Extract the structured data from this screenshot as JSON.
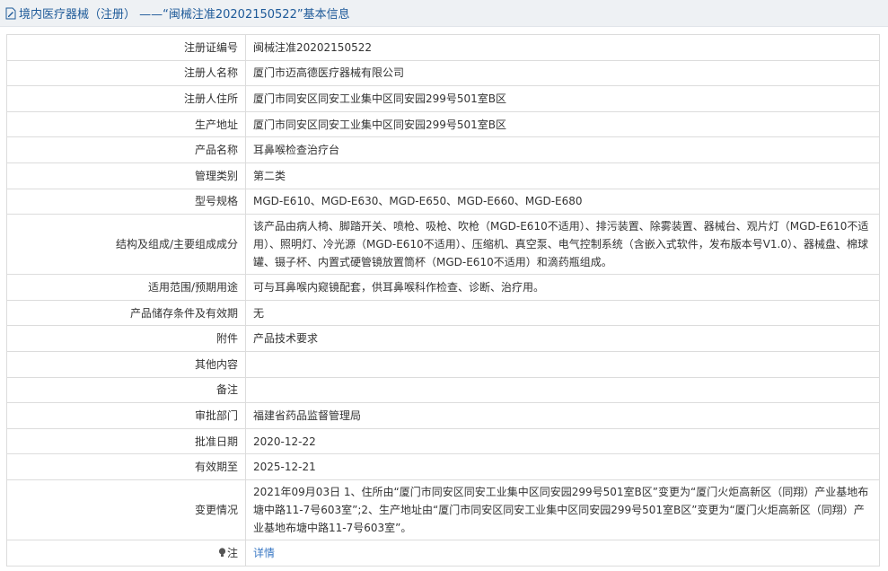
{
  "header": {
    "title": "境内医疗器械（注册） ——“闽械注准20202150522”基本信息"
  },
  "rows": [
    {
      "label": "注册证编号",
      "value": "闽械注准20202150522"
    },
    {
      "label": "注册人名称",
      "value": "厦门市迈高德医疗器械有限公司"
    },
    {
      "label": "注册人住所",
      "value": "厦门市同安区同安工业集中区同安园299号501室B区"
    },
    {
      "label": "生产地址",
      "value": "厦门市同安区同安工业集中区同安园299号501室B区"
    },
    {
      "label": "产品名称",
      "value": "耳鼻喉检查治疗台"
    },
    {
      "label": "管理类别",
      "value": "第二类"
    },
    {
      "label": "型号规格",
      "value": "MGD-E610、MGD-E630、MGD-E650、MGD-E660、MGD-E680"
    },
    {
      "label": "结构及组成/主要组成成分",
      "value": "该产品由病人椅、脚踏开关、喷枪、吸枪、吹枪（MGD-E610不适用）、排污装置、除雾装置、器械台、观片灯（MGD-E610不适用）、照明灯、冷光源（MGD-E610不适用）、压缩机、真空泵、电气控制系统（含嵌入式软件，发布版本号V1.0）、器械盘、棉球罐、镊子杯、内置式硬管镜放置筒杯（MGD-E610不适用）和滴药瓶组成。"
    },
    {
      "label": "适用范围/预期用途",
      "value": "可与耳鼻喉内窥镜配套，供耳鼻喉科作检查、诊断、治疗用。"
    },
    {
      "label": "产品储存条件及有效期",
      "value": "无"
    },
    {
      "label": "附件",
      "value": "产品技术要求"
    },
    {
      "label": "其他内容",
      "value": ""
    },
    {
      "label": "备注",
      "value": ""
    },
    {
      "label": "审批部门",
      "value": "福建省药品监督管理局"
    },
    {
      "label": "批准日期",
      "value": "2020-12-22"
    },
    {
      "label": "有效期至",
      "value": "2025-12-21"
    },
    {
      "label": "变更情况",
      "value": "2021年09月03日 1、住所由“厦门市同安区同安工业集中区同安园299号501室B区”变更为“厦门火炬高新区（同翔）产业基地布塘中路11-7号603室”;2、生产地址由“厦门市同安区同安工业集中区同安园299号501室B区”变更为“厦门火炬高新区（同翔）产业基地布塘中路11-7号603室”。"
    }
  ],
  "note": {
    "label": "注",
    "icon": "lightbulb-icon",
    "link_text": "详情"
  },
  "colors": {
    "title": "#1e5a99",
    "link": "#3a78c4",
    "border": "#dcdcdc",
    "header_bg": "#eef1f4"
  }
}
